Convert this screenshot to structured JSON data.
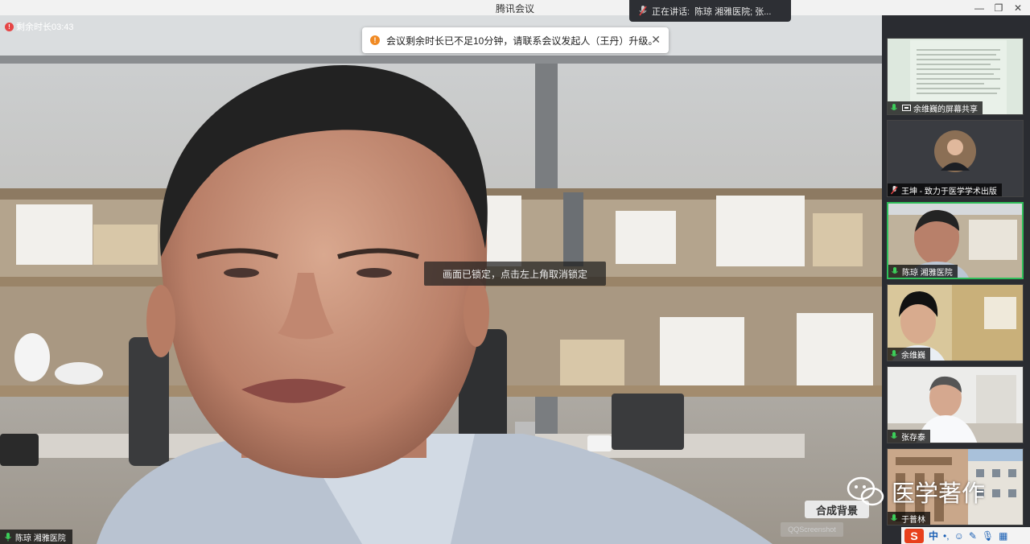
{
  "window": {
    "title": "腾讯会议"
  },
  "speaking": {
    "label": "正在讲话:",
    "names": "陈琼  湘雅医院; 张..."
  },
  "main": {
    "timer": "剩余时长03:43",
    "notice": "会议剩余时长已不足10分钟，请联系会议发起人（王丹）升级。",
    "locked_hint": "画面已锁定，点击左上角取消锁定",
    "speaker_name": "陈琼  湘雅医院",
    "background_badge": "合成背景",
    "qq_tag": "QQScreenshot"
  },
  "participants": [
    {
      "name": "余维巍的屏幕共享",
      "mic": "on",
      "screen_share": true
    },
    {
      "name": "王坤 - 致力于医学学术出版",
      "mic": "muted"
    },
    {
      "name": "陈琼  湘雅医院",
      "mic": "on",
      "active": true
    },
    {
      "name": "余维巍",
      "mic": "on"
    },
    {
      "name": "张存泰",
      "mic": "on"
    },
    {
      "name": "于普林",
      "mic": "on"
    }
  ],
  "watermark": {
    "text": "医学著作"
  },
  "ime": {
    "logo": "S",
    "lang": "中"
  },
  "colors": {
    "active_border": "#2fbe5a",
    "warning": "#f08a24",
    "timer_dot": "#e64545",
    "mic_green": "#3ccf5a"
  }
}
